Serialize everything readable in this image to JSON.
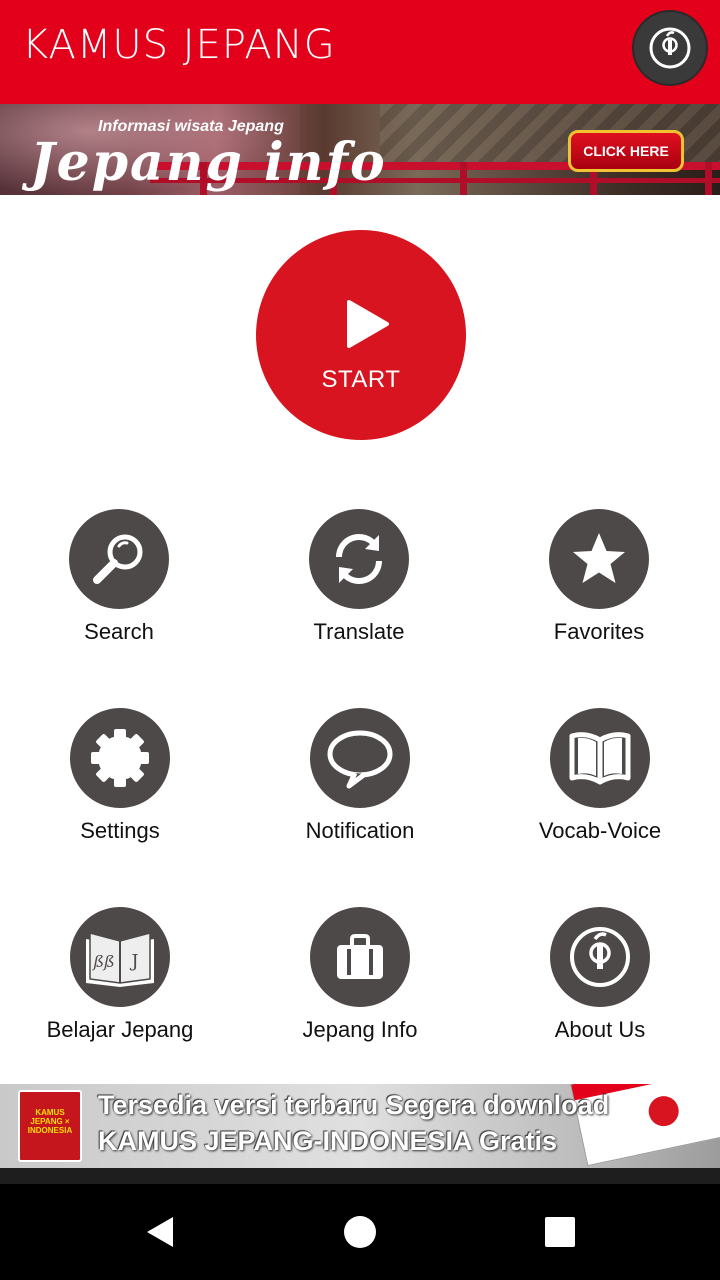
{
  "header": {
    "title": "KAMUS JEPANG",
    "icon": "about-info-icon"
  },
  "banner": {
    "subtitle": "Informasi wisata Jepang",
    "logo_text": "Jepang info",
    "cta": "CLICK HERE"
  },
  "start": {
    "label": "START",
    "icon": "play-icon"
  },
  "menu": {
    "items": [
      {
        "label": "Search",
        "icon": "search-icon"
      },
      {
        "label": "Translate",
        "icon": "translate-icon"
      },
      {
        "label": "Favorites",
        "icon": "star-icon"
      },
      {
        "label": "Settings",
        "icon": "gear-icon"
      },
      {
        "label": "Notification",
        "icon": "speech-bubble-icon"
      },
      {
        "label": "Vocab-Voice",
        "icon": "book-icon"
      },
      {
        "label": "Belajar Jepang",
        "icon": "learn-book-icon"
      },
      {
        "label": "Jepang Info",
        "icon": "briefcase-icon"
      },
      {
        "label": "About Us",
        "icon": "about-info-icon"
      }
    ]
  },
  "ad": {
    "line1": "Tersedia versi terbaru Segera download",
    "line2": "KAMUS JEPANG-INDONESIA Gratis",
    "book_title": "KAMUS JEPANG × INDONESIA"
  },
  "colors": {
    "primary": "#e3001b",
    "start": "#d7141f",
    "icon_circle": "#4d4948"
  }
}
